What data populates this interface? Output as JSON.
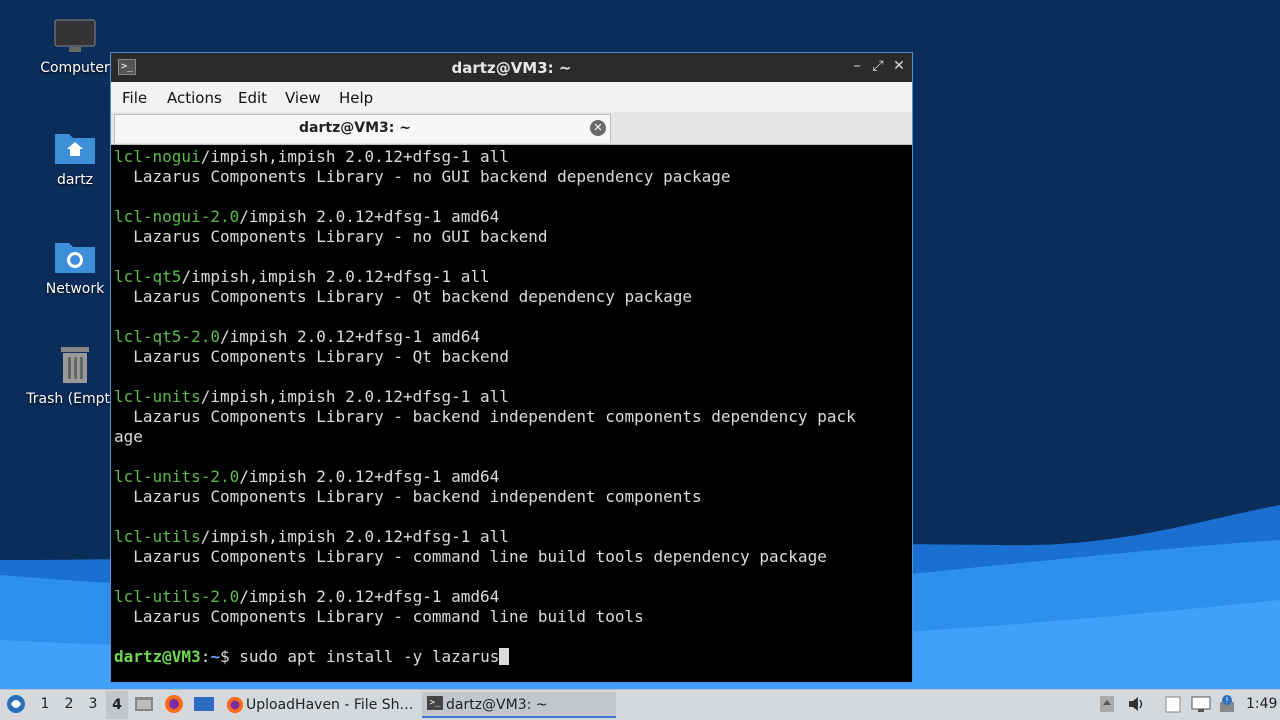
{
  "desktop": {
    "icons": [
      {
        "label": "Computer",
        "icon": "monitor-icon"
      },
      {
        "label": "dartz",
        "icon": "home-folder-icon"
      },
      {
        "label": "Network",
        "icon": "network-folder-icon"
      },
      {
        "label": "Trash (Empty)",
        "icon": "trash-icon"
      }
    ]
  },
  "window": {
    "title": "dartz@VM3: ~",
    "menu": [
      "File",
      "Actions",
      "Edit",
      "View",
      "Help"
    ],
    "tab_label": "dartz@VM3: ~",
    "buttons": [
      "minimize-icon",
      "maximize-icon",
      "close-icon"
    ]
  },
  "terminal": {
    "lines": [
      {
        "pkg": "lcl-nogui",
        "rest": "/impish,impish 2.0.12+dfsg-1 all"
      },
      {
        "pkg": "",
        "rest": "  Lazarus Components Library - no GUI backend dependency package"
      },
      {
        "pkg": "",
        "rest": ""
      },
      {
        "pkg": "lcl-nogui-2.0",
        "rest": "/impish 2.0.12+dfsg-1 amd64"
      },
      {
        "pkg": "",
        "rest": "  Lazarus Components Library - no GUI backend"
      },
      {
        "pkg": "",
        "rest": ""
      },
      {
        "pkg": "lcl-qt5",
        "rest": "/impish,impish 2.0.12+dfsg-1 all"
      },
      {
        "pkg": "",
        "rest": "  Lazarus Components Library - Qt backend dependency package"
      },
      {
        "pkg": "",
        "rest": ""
      },
      {
        "pkg": "lcl-qt5-2.0",
        "rest": "/impish 2.0.12+dfsg-1 amd64"
      },
      {
        "pkg": "",
        "rest": "  Lazarus Components Library - Qt backend"
      },
      {
        "pkg": "",
        "rest": ""
      },
      {
        "pkg": "lcl-units",
        "rest": "/impish,impish 2.0.12+dfsg-1 all"
      },
      {
        "pkg": "",
        "rest": "  Lazarus Components Library - backend independent components dependency pack"
      },
      {
        "pkg": "",
        "rest": "age"
      },
      {
        "pkg": "",
        "rest": ""
      },
      {
        "pkg": "lcl-units-2.0",
        "rest": "/impish 2.0.12+dfsg-1 amd64"
      },
      {
        "pkg": "",
        "rest": "  Lazarus Components Library - backend independent components"
      },
      {
        "pkg": "",
        "rest": ""
      },
      {
        "pkg": "lcl-utils",
        "rest": "/impish,impish 2.0.12+dfsg-1 all"
      },
      {
        "pkg": "",
        "rest": "  Lazarus Components Library - command line build tools dependency package"
      },
      {
        "pkg": "",
        "rest": ""
      },
      {
        "pkg": "lcl-utils-2.0",
        "rest": "/impish 2.0.12+dfsg-1 amd64"
      },
      {
        "pkg": "",
        "rest": "  Lazarus Components Library - command line build tools"
      },
      {
        "pkg": "",
        "rest": ""
      }
    ],
    "prompt": {
      "user": "dartz@VM3",
      "sep": ":",
      "path": "~",
      "symbol": "$",
      "command": " sudo apt install -y lazarus"
    }
  },
  "taskbar": {
    "workspaces": [
      "1",
      "2",
      "3",
      "4"
    ],
    "active_workspace": "4",
    "tasks": [
      {
        "label": "UploadHaven - File Sh…",
        "icon": "firefox-icon"
      },
      {
        "label": "dartz@VM3: ~",
        "icon": "terminal-icon"
      }
    ],
    "clock": "1:49"
  }
}
